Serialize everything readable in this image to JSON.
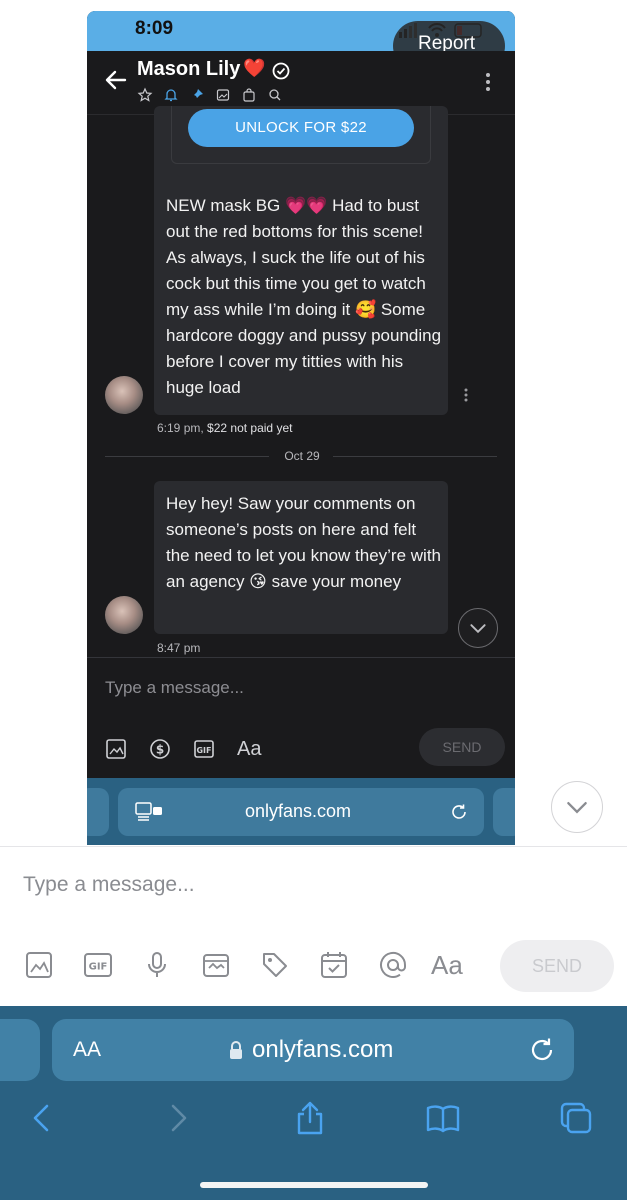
{
  "inner_screenshot": {
    "status_bar": {
      "time": "8:09",
      "report_label": "Report"
    },
    "header": {
      "contact_name": "Mason Lily",
      "name_emoji": "❤️",
      "verified_icon": "verified-check-icon",
      "back_icon": "arrow-left-icon",
      "icons": [
        "star-icon",
        "bell-icon",
        "pin-icon",
        "image-icon",
        "bag-icon",
        "search-icon"
      ],
      "menu_icon": "kebab-icon"
    },
    "messages": [
      {
        "unlock_label": "UNLOCK FOR $22",
        "text": "NEW mask BG 💗💗 Had to bust out the red bottoms for this scene! As always, I suck the life out of his cock but this time you get to watch my ass while I’m doing it 🥰 Some hardcore doggy and pussy pounding before I cover my titties with his huge load",
        "time": "6:19 pm,",
        "price_status": "$22 not paid yet"
      },
      {
        "text": "Hey hey! Saw your comments on someone’s posts on here and felt the need to let you know they’re with an agency 😘 save your money",
        "time": "8:47 pm"
      }
    ],
    "date_divider": "Oct 29",
    "compose": {
      "placeholder": "Type a message...",
      "tools": [
        "image-icon",
        "dollar-icon",
        "gif-icon"
      ],
      "font_label": "Aa",
      "send_label": "SEND"
    },
    "browser": {
      "url": "onlyfans.com"
    }
  },
  "compose": {
    "placeholder": "Type a message...",
    "tools": [
      "image-icon",
      "gif-icon",
      "microphone-icon",
      "vault-icon",
      "price-tag-icon",
      "calendar-icon",
      "at-icon"
    ],
    "font_label": "Aa",
    "send_label": "SEND"
  },
  "browser": {
    "text_size_label": "AA",
    "url": "onlyfans.com",
    "nav": [
      "back-icon",
      "forward-icon",
      "share-icon",
      "bookmarks-icon",
      "tabs-icon"
    ]
  },
  "colors": {
    "accent_blue": "#4aa3e6",
    "dark_bg": "#1a1a1c",
    "bubble_bg": "#2a2b2f",
    "safari_bar": "#2a6182"
  }
}
